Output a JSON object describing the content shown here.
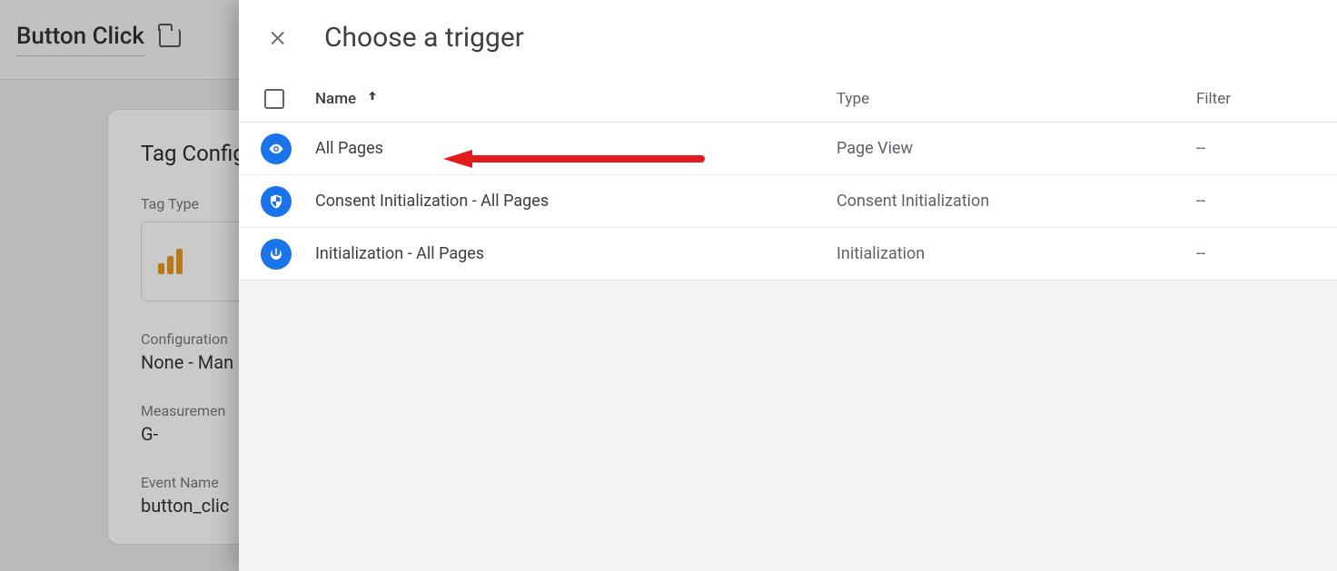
{
  "background": {
    "title": "Button Click",
    "card_title": "Tag Config",
    "tag_type_label": "Tag Type",
    "config_label": "Configuration",
    "config_value": "None - Man",
    "measurement_label": "Measuremen",
    "measurement_value": "G-",
    "event_name_label": "Event Name",
    "event_name_value": "button_clic"
  },
  "panel": {
    "title": "Choose a trigger",
    "columns": {
      "name": "Name",
      "type": "Type",
      "filter": "Filter"
    },
    "rows": [
      {
        "icon": "eye",
        "name": "All Pages",
        "type": "Page View",
        "filter": "--"
      },
      {
        "icon": "shield",
        "name": "Consent Initialization - All Pages",
        "type": "Consent Initialization",
        "filter": "--"
      },
      {
        "icon": "power",
        "name": "Initialization - All Pages",
        "type": "Initialization",
        "filter": "--"
      }
    ]
  }
}
